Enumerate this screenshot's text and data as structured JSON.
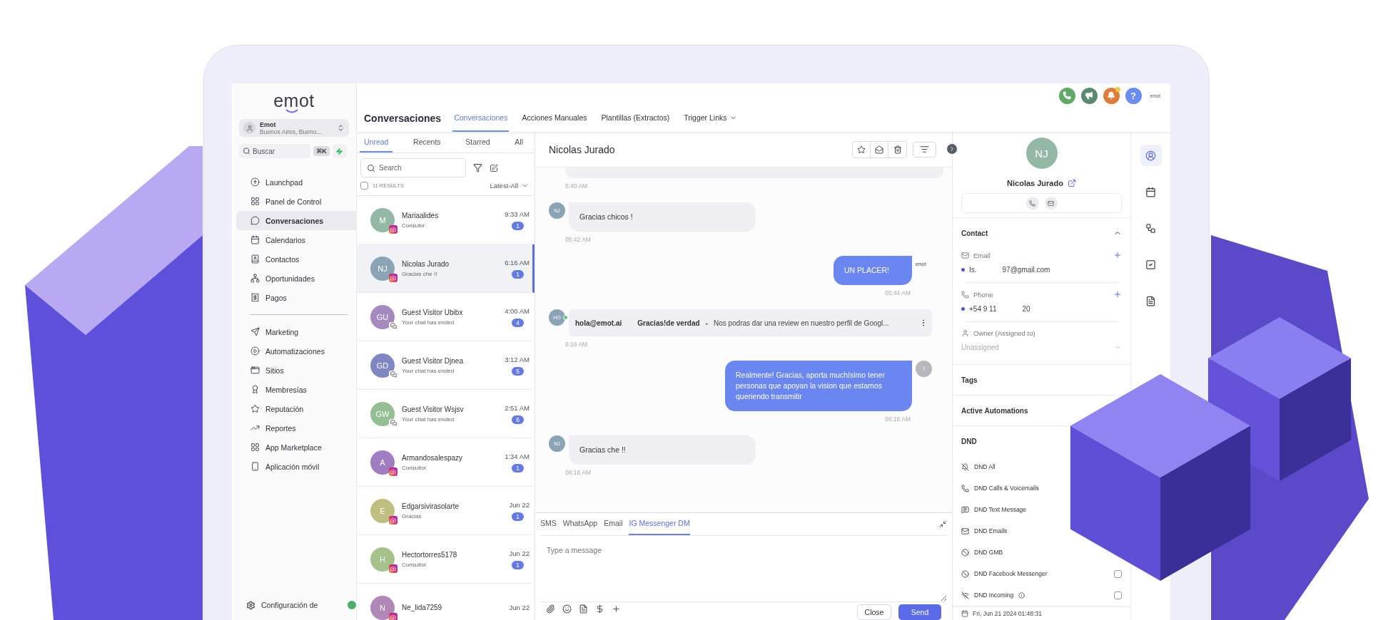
{
  "brand": {
    "logo": "emot"
  },
  "account": {
    "name": "Emot",
    "location": "Buenos Aires, Bueno..."
  },
  "sidebar_search": {
    "placeholder": "Buscar",
    "shortcut": "⌘K"
  },
  "nav_groups": [
    [
      {
        "label": "Launchpad",
        "selected": false
      },
      {
        "label": "Panel de Control",
        "selected": false
      },
      {
        "label": "Conversaciones",
        "selected": true
      },
      {
        "label": "Calendarios",
        "selected": false
      },
      {
        "label": "Contactos",
        "selected": false
      },
      {
        "label": "Oportunidades",
        "selected": false
      },
      {
        "label": "Pagos",
        "selected": false
      }
    ],
    [
      {
        "label": "Marketing",
        "selected": false
      },
      {
        "label": "Automatizaciones",
        "selected": false
      },
      {
        "label": "Sitios",
        "selected": false
      },
      {
        "label": "Membresías",
        "selected": false
      },
      {
        "label": "Reputación",
        "selected": false
      },
      {
        "label": "Reportes",
        "selected": false
      },
      {
        "label": "App Marketplace",
        "selected": false
      },
      {
        "label": "Aplicación móvil",
        "selected": false
      }
    ]
  ],
  "sidebar_footer": {
    "label": "Configuración de"
  },
  "top_actions": [
    {
      "color": "#5fa865",
      "notification": false
    },
    {
      "color": "#5b8a72",
      "notification": false
    },
    {
      "color": "#e07b39",
      "notification": true
    },
    {
      "color": "#6b8cf0",
      "notification": false,
      "label": "?"
    }
  ],
  "top_logo": "emot",
  "header": {
    "title": "Conversaciones",
    "tabs": [
      {
        "label": "Conversaciones",
        "selected": true,
        "dropdown": false
      },
      {
        "label": "Acciones Manuales",
        "selected": false,
        "dropdown": false
      },
      {
        "label": "Plantillas (Extractos)",
        "selected": false,
        "dropdown": false
      },
      {
        "label": "Trigger Links",
        "selected": false,
        "dropdown": true
      }
    ]
  },
  "list_tabs": [
    {
      "label": "Unread",
      "selected": true
    },
    {
      "label": "Recents",
      "selected": false
    },
    {
      "label": "Starred",
      "selected": false
    },
    {
      "label": "All",
      "selected": false
    }
  ],
  "list_search": {
    "placeholder": "Search"
  },
  "results": {
    "count": "11 RESULTS",
    "sort": "Latest-All",
    "checked": false
  },
  "conversations": [
    {
      "initials": "M",
      "name": "Mariaalides",
      "preview": "Consutor",
      "time": "9:33 AM",
      "unread": "1",
      "kind": "instagram",
      "color": "#93b8a6",
      "selected": false
    },
    {
      "initials": "NJ",
      "name": "Nicolas Jurado",
      "preview": "Gracias che !!",
      "time": "6:16 AM",
      "unread": "1",
      "kind": "instagram",
      "color": "#8aa3b5",
      "selected": true
    },
    {
      "initials": "GU",
      "name": "Guest Visitor Ubibx",
      "preview": "Your chat has ended",
      "time": "4:00 AM",
      "unread": "4",
      "kind": "chat",
      "color": "#a58ac0",
      "selected": false
    },
    {
      "initials": "GD",
      "name": "Guest Visitor Djnea",
      "preview": "Your chat has ended",
      "time": "3:12 AM",
      "unread": "5",
      "kind": "chat",
      "color": "#7f86c2",
      "selected": false
    },
    {
      "initials": "GW",
      "name": "Guest Visitor Wsjsv",
      "preview": "Your chat has ended",
      "time": "2:51 AM",
      "unread": "6",
      "kind": "chat",
      "color": "#94bf94",
      "selected": false
    },
    {
      "initials": "A",
      "name": "Armandosalespazy",
      "preview": "Consultor",
      "time": "1:34 AM",
      "unread": "1",
      "kind": "instagram",
      "color": "#a07cc0",
      "selected": false
    },
    {
      "initials": "E",
      "name": "Edgarsivirasolarte",
      "preview": "Gracias",
      "time": "Jun 22",
      "unread": "1",
      "kind": "instagram",
      "color": "#bfbf80",
      "selected": false
    },
    {
      "initials": "H",
      "name": "Hectortorres5178",
      "preview": "Consultor",
      "time": "Jun 22",
      "unread": "1",
      "kind": "instagram",
      "color": "#a5c28a",
      "selected": false
    },
    {
      "initials": "N",
      "name": "Ne_lida7259",
      "time": "Jun 22",
      "kind": "instagram",
      "color": "#b088b8",
      "selected": false
    }
  ],
  "chat": {
    "title": "Nicolas Jurado",
    "messages": [
      {
        "kind": "clipped",
        "time": "5:40 AM"
      },
      {
        "kind": "incoming",
        "avatar": "NJ",
        "text": "Gracias chicos !",
        "time": "05:42 AM"
      },
      {
        "kind": "outgoing",
        "sender_logo": "emot",
        "text": "UN PLACER!",
        "time": "05:44 AM"
      },
      {
        "kind": "email",
        "avatar": "HO",
        "from": "hola@emot.ai",
        "subject": "Gracias!de verdad",
        "separator": "-",
        "snippet": "Nos podras dar una review en nuestro perfil de Googl...",
        "time": "6:16 AM"
      },
      {
        "kind": "outgoing",
        "avatar": "?",
        "text": "Realmente! Gracias, aporta muchísimo tener personas que apoyan la vision que estamos queriendo transmitir",
        "time": "06:16 AM"
      },
      {
        "kind": "incoming",
        "avatar": "NJ",
        "text": "Gracias che !!",
        "time": "06:16 AM"
      }
    ]
  },
  "composer": {
    "tabs": [
      {
        "label": "SMS",
        "selected": false
      },
      {
        "label": "WhatsApp",
        "selected": false
      },
      {
        "label": "Email",
        "selected": false
      },
      {
        "label": "IG Messenger DM",
        "selected": true
      }
    ],
    "placeholder": "Type a message",
    "buttons": [
      "Close",
      "Send"
    ]
  },
  "contact": {
    "initials": "NJ",
    "name": "Nicolas Jurado",
    "section": "Contact",
    "expanded": true,
    "email": {
      "label": "Email",
      "value_parts": [
        "Is.",
        "97@gmail.com"
      ]
    },
    "phone": {
      "label": "Phone",
      "value_parts": [
        "+54 9 11",
        "20"
      ]
    },
    "owner": {
      "label": "Owner (Assigned to)",
      "placeholder": "Unassigned"
    },
    "sections": [
      "Tags",
      "Active Automations"
    ],
    "dnd": {
      "title": "DND",
      "items": [
        {
          "label": "DND All"
        },
        {
          "label": "DND Calls & Voicemails"
        },
        {
          "label": "DND Text Message"
        },
        {
          "label": "DND Emails"
        },
        {
          "label": "DND GMB"
        },
        {
          "label": "DND Facebook Messenger",
          "checked": false
        },
        {
          "label": "DND Incoming",
          "checked": false,
          "info": true
        }
      ]
    },
    "timestamp": "Fri, Jun 21 2024 01:48:31"
  },
  "rail": [
    {
      "selected": true
    },
    {
      "selected": false
    },
    {
      "selected": false
    },
    {
      "selected": false
    },
    {
      "selected": false
    }
  ]
}
